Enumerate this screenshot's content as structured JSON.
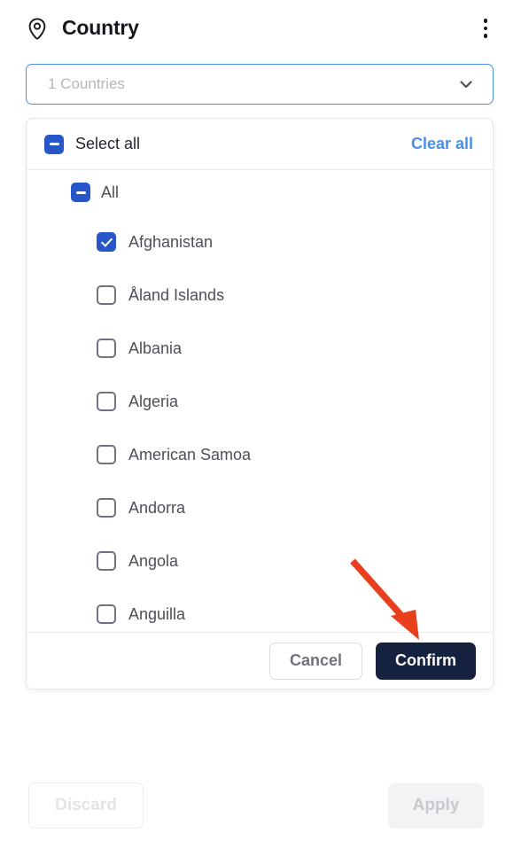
{
  "header": {
    "title": "Country",
    "pin_icon": "location-pin-icon",
    "menu_icon": "kebab-menu-icon"
  },
  "select": {
    "value": "1 Countries",
    "placeholder": "1 Countries",
    "chevron_icon": "chevron-down-icon"
  },
  "dropdown": {
    "select_all_label": "Select all",
    "clear_all_label": "Clear all",
    "group": {
      "label": "All",
      "expanded": true,
      "collapse_icon": "chevron-up-icon",
      "state": "indeterminate"
    },
    "items": [
      {
        "label": "Afghanistan",
        "checked": true
      },
      {
        "label": "Åland Islands",
        "checked": false
      },
      {
        "label": "Albania",
        "checked": false
      },
      {
        "label": "Algeria",
        "checked": false
      },
      {
        "label": "American Samoa",
        "checked": false
      },
      {
        "label": "Andorra",
        "checked": false
      },
      {
        "label": "Angola",
        "checked": false
      },
      {
        "label": "Anguilla",
        "checked": false
      }
    ],
    "footer": {
      "cancel_label": "Cancel",
      "confirm_label": "Confirm"
    }
  },
  "actions": {
    "discard_label": "Discard",
    "apply_label": "Apply"
  },
  "annotation": {
    "arrow_icon": "red-arrow-icon",
    "color": "#e8401f",
    "points_to": "Confirm"
  },
  "colors": {
    "accent_blue": "#2656c8",
    "link_blue": "#4a90e8",
    "focus_border": "#4a90e8",
    "confirm_navy": "#14213f",
    "annotation_red": "#e8401f"
  }
}
